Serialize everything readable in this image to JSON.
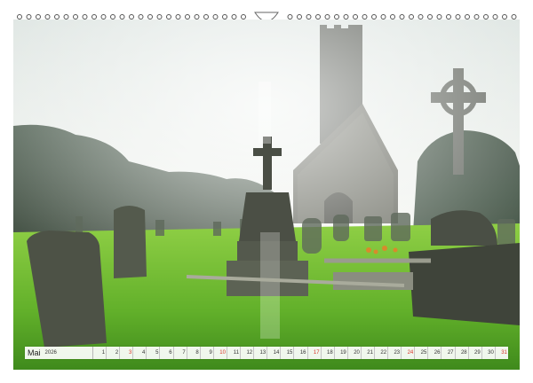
{
  "calendar": {
    "month": "Mai",
    "year": "2026",
    "days": [
      {
        "d": "1",
        "sunday": false
      },
      {
        "d": "2",
        "sunday": false
      },
      {
        "d": "3",
        "sunday": true
      },
      {
        "d": "4",
        "sunday": false
      },
      {
        "d": "5",
        "sunday": false
      },
      {
        "d": "6",
        "sunday": false
      },
      {
        "d": "7",
        "sunday": false
      },
      {
        "d": "8",
        "sunday": false
      },
      {
        "d": "9",
        "sunday": false
      },
      {
        "d": "10",
        "sunday": true
      },
      {
        "d": "11",
        "sunday": false
      },
      {
        "d": "12",
        "sunday": false
      },
      {
        "d": "13",
        "sunday": false
      },
      {
        "d": "14",
        "sunday": false
      },
      {
        "d": "15",
        "sunday": false
      },
      {
        "d": "16",
        "sunday": false
      },
      {
        "d": "17",
        "sunday": true
      },
      {
        "d": "18",
        "sunday": false
      },
      {
        "d": "19",
        "sunday": false
      },
      {
        "d": "20",
        "sunday": false
      },
      {
        "d": "21",
        "sunday": false
      },
      {
        "d": "22",
        "sunday": false
      },
      {
        "d": "23",
        "sunday": false
      },
      {
        "d": "24",
        "sunday": true
      },
      {
        "d": "25",
        "sunday": false
      },
      {
        "d": "26",
        "sunday": false
      },
      {
        "d": "27",
        "sunday": false
      },
      {
        "d": "28",
        "sunday": false
      },
      {
        "d": "29",
        "sunday": false
      },
      {
        "d": "30",
        "sunday": false
      },
      {
        "d": "31",
        "sunday": true
      }
    ]
  },
  "colors": {
    "sunday": "#d9352a",
    "grass": "#6fbf2c",
    "sky": "#eef2ee"
  },
  "icons": {
    "binding": "spiral-binding-rings",
    "hanger": "hanger-notch-icon"
  }
}
